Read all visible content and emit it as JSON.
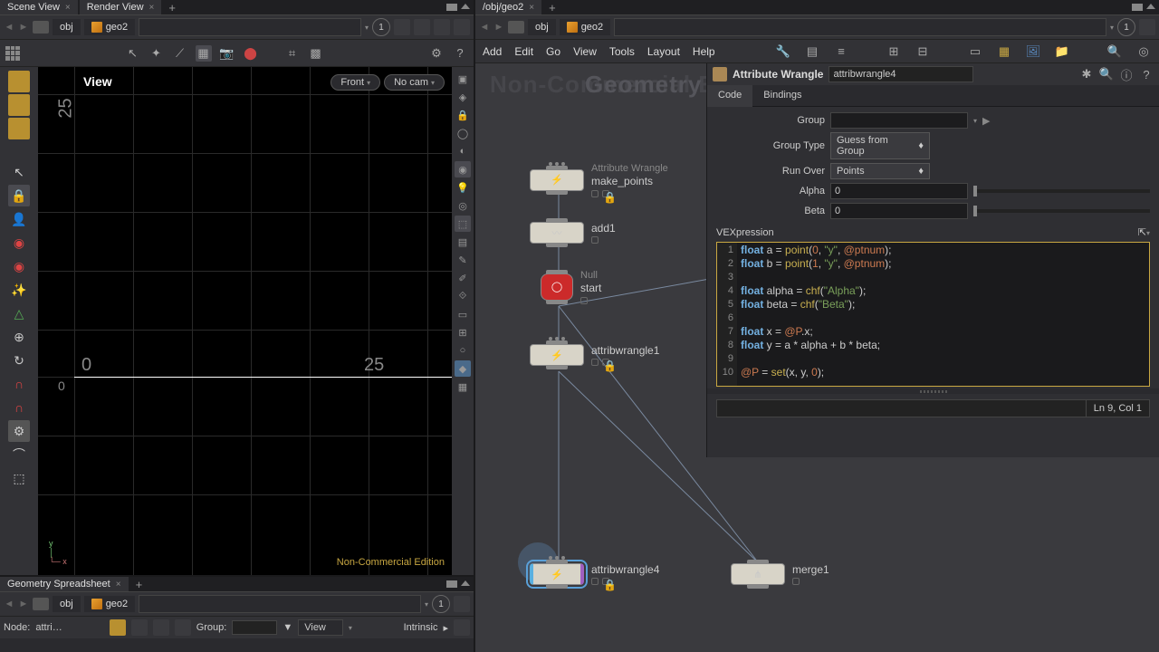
{
  "left": {
    "tabs": [
      "Scene View",
      "Render View"
    ],
    "path": {
      "level1": "obj",
      "level2": "geo2",
      "badge": "1"
    },
    "viewport": {
      "label": "View",
      "front": "Front",
      "cam": "No cam",
      "axis_y": "25",
      "axis_x0": "0",
      "axis_x25": "25",
      "origin": "0",
      "edition": "Non-Commercial Edition"
    },
    "spreadsheet": {
      "tab": "Geometry Spreadsheet",
      "path": {
        "level1": "obj",
        "level2": "geo2",
        "badge": "1"
      },
      "node_label": "Node:",
      "node_value": "attri…",
      "group_label": "Group:",
      "view": "View",
      "intrinsic": "Intrinsic"
    }
  },
  "right": {
    "tabs": [
      "/obj/geo2"
    ],
    "path": {
      "level1": "obj",
      "level2": "geo2",
      "badge": "1"
    },
    "menu": [
      "Add",
      "Edit",
      "Go",
      "View",
      "Tools",
      "Layout",
      "Help"
    ],
    "watermark1": "Non-Commercial Edition",
    "watermark2": "Geometry",
    "nodes": {
      "make_points": {
        "type": "Attribute Wrangle",
        "name": "make_points"
      },
      "add1": {
        "name": "add1"
      },
      "start": {
        "type": "Null",
        "name": "start"
      },
      "attribwrangle1": {
        "name": "attribwrangle1"
      },
      "attribwrangle4": {
        "name": "attribwrangle4"
      },
      "merge1": {
        "name": "merge1"
      }
    },
    "param": {
      "title": "Attribute Wrangle",
      "name_value": "attribwrangle4",
      "tabs": [
        "Code",
        "Bindings"
      ],
      "group_label": "Group",
      "group_value": "",
      "group_type_label": "Group Type",
      "group_type_value": "Guess from Group",
      "run_over_label": "Run Over",
      "run_over_value": "Points",
      "alpha_label": "Alpha",
      "alpha_value": "0",
      "beta_label": "Beta",
      "beta_value": "0",
      "vex_label": "VEXpression",
      "status": "Ln 9, Col 1",
      "code_lines": [
        {
          "n": 1,
          "seg": [
            [
              "kw",
              "float"
            ],
            [
              "",
              " a = "
            ],
            [
              "fn",
              "point"
            ],
            [
              "",
              "("
            ],
            [
              "num",
              "0"
            ],
            [
              "",
              ", "
            ],
            [
              "str",
              "\"y\""
            ],
            [
              "",
              ", "
            ],
            [
              "attr",
              "@ptnum"
            ],
            [
              "",
              ");"
            ]
          ]
        },
        {
          "n": 2,
          "seg": [
            [
              "kw",
              "float"
            ],
            [
              "",
              " b = "
            ],
            [
              "fn",
              "point"
            ],
            [
              "",
              "("
            ],
            [
              "num",
              "1"
            ],
            [
              "",
              ", "
            ],
            [
              "str",
              "\"y\""
            ],
            [
              "",
              ", "
            ],
            [
              "attr",
              "@ptnum"
            ],
            [
              "",
              ");"
            ]
          ]
        },
        {
          "n": 3,
          "seg": [
            [
              "",
              ""
            ]
          ]
        },
        {
          "n": 4,
          "seg": [
            [
              "kw",
              "float"
            ],
            [
              "",
              " alpha = "
            ],
            [
              "fn",
              "chf"
            ],
            [
              "",
              "("
            ],
            [
              "str",
              "\"Alpha\""
            ],
            [
              "",
              ");"
            ]
          ]
        },
        {
          "n": 5,
          "seg": [
            [
              "kw",
              "float"
            ],
            [
              "",
              " beta = "
            ],
            [
              "fn",
              "chf"
            ],
            [
              "",
              "("
            ],
            [
              "str",
              "\"Beta\""
            ],
            [
              "",
              ");"
            ]
          ]
        },
        {
          "n": 6,
          "seg": [
            [
              "",
              ""
            ]
          ]
        },
        {
          "n": 7,
          "seg": [
            [
              "kw",
              "float"
            ],
            [
              "",
              " x = "
            ],
            [
              "attr",
              "@P"
            ],
            [
              "",
              ".x;"
            ]
          ]
        },
        {
          "n": 8,
          "seg": [
            [
              "kw",
              "float"
            ],
            [
              "",
              " y = a * alpha + b * beta;"
            ]
          ]
        },
        {
          "n": 9,
          "seg": [
            [
              "",
              ""
            ]
          ]
        },
        {
          "n": 10,
          "seg": [
            [
              "attr",
              "@P"
            ],
            [
              "",
              " = "
            ],
            [
              "fn",
              "set"
            ],
            [
              "",
              "(x, y, "
            ],
            [
              "num",
              "0"
            ],
            [
              "",
              ");"
            ]
          ]
        }
      ]
    }
  }
}
